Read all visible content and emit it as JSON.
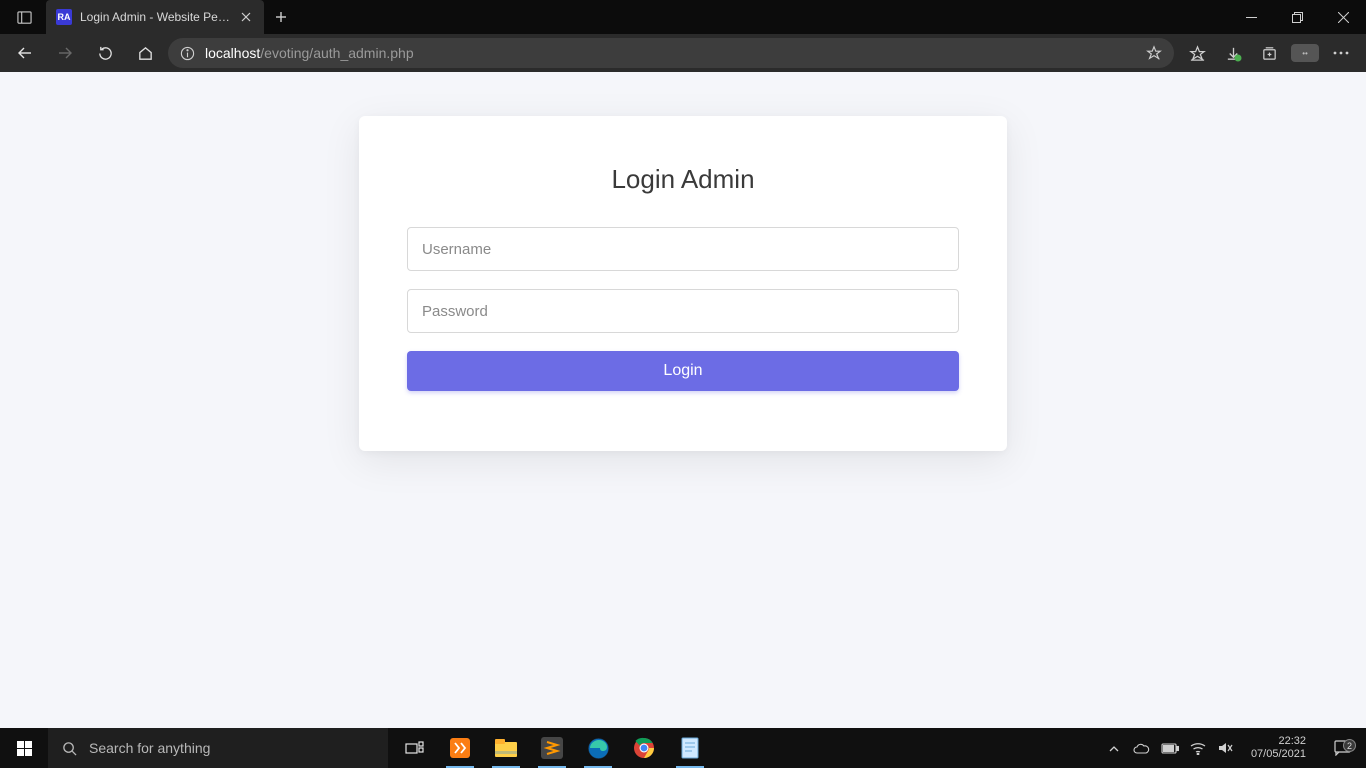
{
  "browser": {
    "tab": {
      "favicon_text": "RA",
      "title": "Login Admin - Website Pemilihan"
    },
    "address": {
      "host": "localhost",
      "path": "/evoting/auth_admin.php"
    }
  },
  "page": {
    "card_title": "Login Admin",
    "username_placeholder": "Username",
    "password_placeholder": "Password",
    "login_label": "Login"
  },
  "taskbar": {
    "search_placeholder": "Search for anything",
    "time": "22:32",
    "date": "07/05/2021",
    "notif_count": "2"
  }
}
